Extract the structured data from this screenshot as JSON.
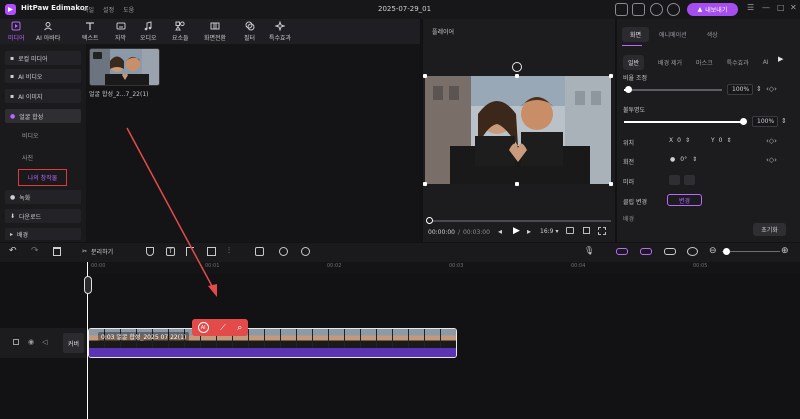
{
  "window": {
    "app_name": "HitPaw Edimakor",
    "menus": [
      "파일",
      "설정",
      "도움"
    ],
    "project_date": "2025-07-29_01",
    "export_label": "내보내기"
  },
  "toolbar": {
    "tools": [
      {
        "label": "미디어",
        "icon": "media-icon",
        "active": true
      },
      {
        "label": "AI 아바타",
        "icon": "avatar-icon",
        "active": false
      },
      {
        "label": "텍스트",
        "icon": "text-icon",
        "active": false
      },
      {
        "label": "자막",
        "icon": "subtitle-icon",
        "active": false
      },
      {
        "label": "오디오",
        "icon": "audio-icon",
        "active": false
      },
      {
        "label": "요소들",
        "icon": "elements-icon",
        "active": false
      },
      {
        "label": "화면전환",
        "icon": "transition-icon",
        "active": false
      },
      {
        "label": "필터",
        "icon": "filter-icon",
        "active": false
      },
      {
        "label": "특수효과",
        "icon": "effects-icon",
        "active": false
      }
    ]
  },
  "sidebar": {
    "items": [
      {
        "label": "로컬 미디어"
      },
      {
        "label": "AI 비디오"
      },
      {
        "label": "AI 이미지"
      },
      {
        "label": "얼굴 합성"
      }
    ],
    "sub_items": [
      "비디오",
      "사진",
      "나의 창작물"
    ],
    "bottom_items": [
      {
        "label": "녹화"
      },
      {
        "label": "다운로드"
      },
      {
        "label": "배경"
      }
    ]
  },
  "media": {
    "thumb_name": "얼굴 합성_2...7_22(1)"
  },
  "player": {
    "title": "플레이어",
    "current_time": "00:00:00",
    "separator": "/",
    "total_time": "00:03:00",
    "aspect_ratio": "16:9"
  },
  "properties": {
    "tabs": [
      "화면",
      "애니메이션",
      "색상"
    ],
    "active_tab": "화면",
    "sub_tabs": [
      "일반",
      "배경 제거",
      "마스크",
      "특수효과",
      "AI"
    ],
    "scale_label": "비율 조정",
    "scale_value": "100%",
    "scale_fraction": 1.0,
    "opacity_label": "불투명도",
    "opacity_value": "100%",
    "opacity_fraction": 1.0,
    "position_label": "위치",
    "pos_x_label": "X",
    "pos_x": "0",
    "pos_y_label": "Y",
    "pos_y": "0",
    "rotate_label": "회전",
    "rotate_value": "0°",
    "mirror_label": "미러",
    "clip_change_label": "클립 변경",
    "change_button": "변경",
    "speed_label": "배경",
    "reset_label": "초기화"
  },
  "timeline": {
    "split_label": "분리하기",
    "ruler_ticks": [
      "00:00",
      "00:01",
      "00:02",
      "00:03",
      "00:04",
      "00:05"
    ],
    "cover_label": "커버",
    "clip_label": "0:03 얼굴 합성_2025 07 22(1)"
  },
  "colors": {
    "accent": "#b867ff",
    "export": "#a64df0",
    "highlight_box": "#e03b3b",
    "clip_bar": "#5a34b5",
    "arrow": "#e34a4a"
  }
}
